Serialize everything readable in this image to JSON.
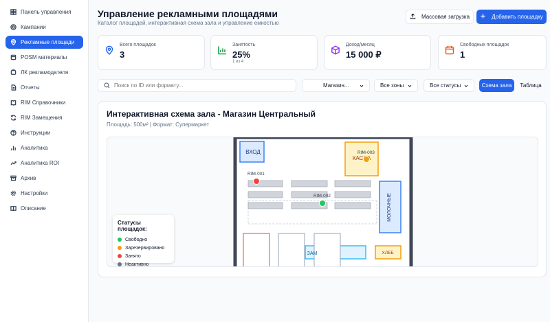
{
  "sidebar": {
    "items": [
      {
        "label": "Панель управления",
        "icon": "home-icon"
      },
      {
        "label": "Кампании",
        "icon": "target-icon"
      },
      {
        "label": "Рекламные площади",
        "icon": "map-pin-icon",
        "active": true
      },
      {
        "label": "POSM материалы",
        "icon": "package-icon"
      },
      {
        "label": "ЛК рекламодателя",
        "icon": "user-icon"
      },
      {
        "label": "Отчеты",
        "icon": "file-icon"
      },
      {
        "label": "RIM Справочники",
        "icon": "book-icon"
      },
      {
        "label": "RIM Замещения",
        "icon": "refresh-icon"
      },
      {
        "label": "Инструкции",
        "icon": "help-icon"
      },
      {
        "label": "Аналитика",
        "icon": "chart-bar-icon"
      },
      {
        "label": "Аналитика ROI",
        "icon": "trend-icon"
      },
      {
        "label": "Архив",
        "icon": "archive-icon"
      },
      {
        "label": "Настройки",
        "icon": "gear-icon"
      },
      {
        "label": "Описание",
        "icon": "book-open-icon"
      }
    ]
  },
  "header": {
    "title": "Управление рекламными площадями",
    "subtitle": "Каталог площадей, интерактивная схема зала и управление емкостью",
    "bulk_label": "Массовая загрузка",
    "add_label": "Добавить площадку"
  },
  "stats": [
    {
      "label": "Всего площадок",
      "value": "3",
      "icon": "map-pin-icon",
      "color": "#2563eb"
    },
    {
      "label": "Занятость",
      "value": "25%",
      "sub": "1 из 4",
      "icon": "chart-bar-icon",
      "color": "#16a34a"
    },
    {
      "label": "Доход/месяц",
      "value": "15 000 ₽",
      "icon": "cube-icon",
      "color": "#9333ea"
    },
    {
      "label": "Свободных площадок",
      "value": "1",
      "icon": "calendar-icon",
      "color": "#ea580c"
    }
  ],
  "filters": {
    "search_placeholder": "Поиск по ID или формату...",
    "store": "Магазин...",
    "zone": "Все зоны",
    "status": "Все статусы",
    "view_schema": "Схема зала",
    "view_table": "Таблица"
  },
  "schema": {
    "title": "Интерактивная схема зала - Магазин Центральный",
    "subtitle": "Площадь: 500м² | Формат: Супермаркет",
    "zones": {
      "entrance": "ВХОД",
      "cashier": "КАССА",
      "dairy": "МОЛОЧНЫЕ",
      "bread": "ХЛЕБ",
      "frozen": "ЗАМ"
    },
    "spots": [
      {
        "id": "RIM-001",
        "status": "occupied"
      },
      {
        "id": "RIM-002",
        "status": "free"
      },
      {
        "id": "RIM-003",
        "status": "reserved"
      }
    ],
    "legend": {
      "title": "Статусы площадок:",
      "items": [
        {
          "label": "Свободно",
          "color": "#22c55e"
        },
        {
          "label": "Зарезервировано",
          "color": "#f59e0b"
        },
        {
          "label": "Занято",
          "color": "#ef4444"
        },
        {
          "label": "Неактивно",
          "color": "#6b7280"
        }
      ]
    }
  },
  "colors": {
    "accent": "#2563eb",
    "free": "#22c55e",
    "reserved": "#f59e0b",
    "occupied": "#ef4444",
    "inactive": "#6b7280"
  }
}
